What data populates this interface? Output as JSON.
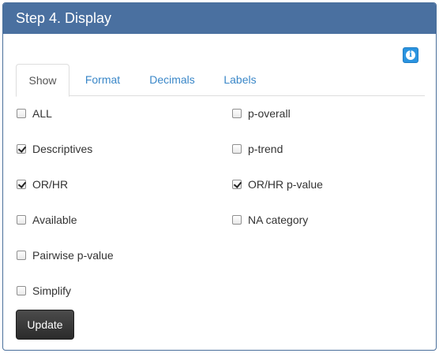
{
  "panel": {
    "title": "Step 4. Display"
  },
  "info_button": {
    "icon": "info-icon",
    "glyph": "i",
    "color": "#2b94e0"
  },
  "tabs": [
    {
      "label": "Show",
      "active": true
    },
    {
      "label": "Format",
      "active": false
    },
    {
      "label": "Decimals",
      "active": false
    },
    {
      "label": "Labels",
      "active": false
    }
  ],
  "options_left": [
    {
      "label": "ALL",
      "checked": false
    },
    {
      "label": "Descriptives",
      "checked": true
    },
    {
      "label": "OR/HR",
      "checked": true
    },
    {
      "label": "Available",
      "checked": false
    },
    {
      "label": "Pairwise p-value",
      "checked": false
    },
    {
      "label": "Simplify",
      "checked": false
    }
  ],
  "options_right": [
    {
      "label": "p-overall",
      "checked": false
    },
    {
      "label": "p-trend",
      "checked": false
    },
    {
      "label": "OR/HR p-value",
      "checked": true
    },
    {
      "label": "NA category",
      "checked": false
    }
  ],
  "update_button": {
    "label": "Update"
  },
  "colors": {
    "header": "#4a70a0",
    "tab_link": "#3a87c8",
    "button_dark": "#333333"
  }
}
